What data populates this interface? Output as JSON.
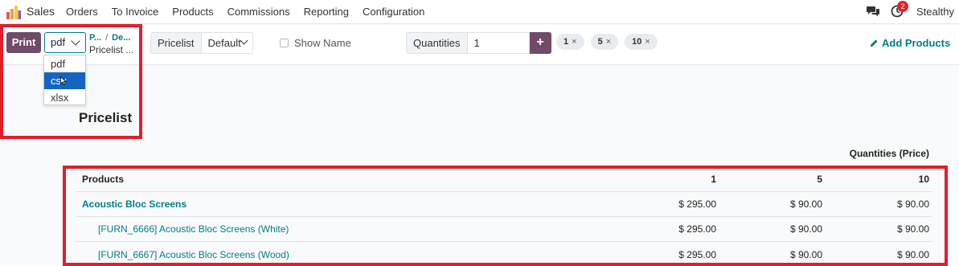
{
  "navbar": {
    "app_name": "Sales",
    "menu": [
      "Orders",
      "To Invoice",
      "Products",
      "Commissions",
      "Reporting",
      "Configuration"
    ],
    "activity_count": "2",
    "company": "Stealthy"
  },
  "toolbar": {
    "print_label": "Print",
    "format_value": "pdf",
    "breadcrumb_first": "P...",
    "breadcrumb_sep": "/",
    "breadcrumb_second": "De...",
    "breadcrumb_current": "Pricelist ...",
    "pricelist_label": "Pricelist",
    "pricelist_value": "Default",
    "show_name_label": "Show Name",
    "quantities_label": "Quantities",
    "quantities_value": "1",
    "add_qty_symbol": "+",
    "quantity_tags": [
      "1",
      "5",
      "10"
    ],
    "tag_remove_symbol": "×",
    "add_products_label": "Add Products"
  },
  "format_options": [
    "pdf",
    "csv",
    "xlsx"
  ],
  "report": {
    "title": "Pricelist",
    "quantities_header": "Quantities (Price)",
    "columns": [
      "Products",
      "1",
      "5",
      "10"
    ],
    "rows": [
      {
        "name": "Acoustic Bloc Screens",
        "q1": "$ 295.00",
        "q5": "$ 90.00",
        "q10": "$ 90.00"
      },
      {
        "name": "[FURN_6666] Acoustic Bloc Screens (White)",
        "q1": "$ 295.00",
        "q5": "$ 90.00",
        "q10": "$ 90.00"
      },
      {
        "name": "[FURN_6667] Acoustic Bloc Screens (Wood)",
        "q1": "$ 295.00",
        "q5": "$ 90.00",
        "q10": "$ 90.00"
      }
    ]
  },
  "colors": {
    "brand": "#714b67",
    "link": "#017e84",
    "annotation": "#e11e2a",
    "selected_option": "#1565c0"
  }
}
